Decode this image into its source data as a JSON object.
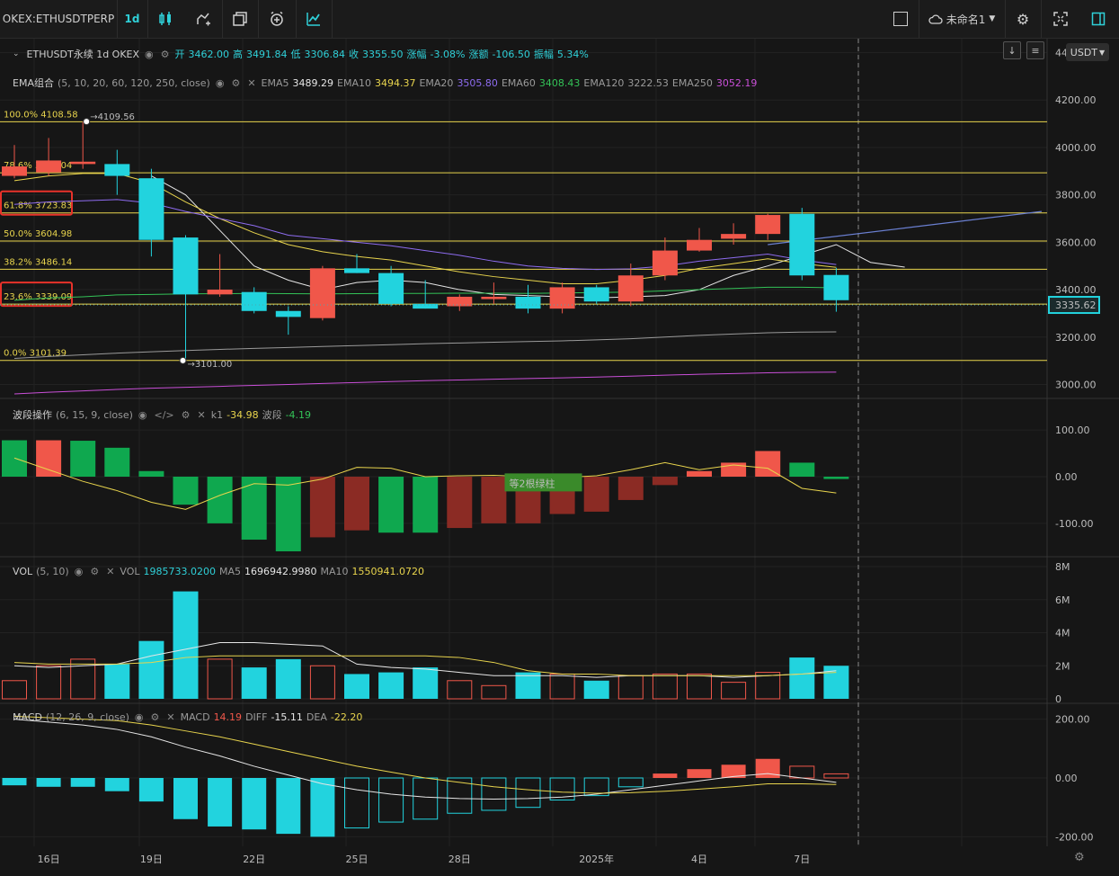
{
  "toolbar": {
    "symbol": "OKEX:ETHUSDTPERP",
    "interval": "1d",
    "layout_name": "未命名1",
    "currency": "USDT"
  },
  "header": {
    "title": "ETHUSDT永续 1d OKEX",
    "open_label": "开",
    "open": "3462.00",
    "high_label": "高",
    "high": "3491.84",
    "low_label": "低",
    "low": "3306.84",
    "close_label": "收",
    "close": "3355.50",
    "chg_pct_label": "涨幅",
    "chg_pct": "-3.08%",
    "chg_label": "涨额",
    "chg": "-106.50",
    "amp_label": "振幅",
    "amp": "5.34%"
  },
  "ema": {
    "name": "EMA组合",
    "params": "(5, 10, 20, 60, 120, 250, close)",
    "values": [
      {
        "label": "EMA5",
        "value": "3489.29",
        "color": "#e6e6e6"
      },
      {
        "label": "EMA10",
        "value": "3494.37",
        "color": "#e8d44d"
      },
      {
        "label": "EMA20",
        "value": "3505.80",
        "color": "#8e6cf0"
      },
      {
        "label": "EMA60",
        "value": "3408.43",
        "color": "#33c257"
      },
      {
        "label": "EMA120",
        "value": "3222.53",
        "color": "#9a9a9a"
      },
      {
        "label": "EMA250",
        "value": "3052.19",
        "color": "#c94fd8"
      }
    ]
  },
  "osc": {
    "name": "波段操作",
    "params": "(6, 15, 9, close)",
    "k1_label": "k1",
    "k1": "-34.98",
    "band_label": "波段",
    "band": "-4.19",
    "annotation": "等2根绿柱"
  },
  "vol": {
    "name": "VOL",
    "params": "(5, 10)",
    "vol_label": "VOL",
    "vol": "1985733.0200",
    "ma5_label": "MA5",
    "ma5": "1696942.9980",
    "ma10_label": "MA10",
    "ma10": "1550941.0720"
  },
  "macd": {
    "name": "MACD",
    "params": "(12, 26, 9, close)",
    "macd_label": "MACD",
    "macd": "14.19",
    "diff_label": "DIFF",
    "diff": "-15.11",
    "dea_label": "DEA",
    "dea": "-22.20"
  },
  "chart_data": {
    "type": "candlestick",
    "price_axis": {
      "ylim": [
        2960,
        4440
      ],
      "ticks": [
        "4400.00",
        "4200.00",
        "4000.00",
        "3800.00",
        "3600.00",
        "3400.00",
        "3200.00",
        "3000.00"
      ],
      "last_price": "3335.62"
    },
    "osc_axis": {
      "ylim": [
        -160,
        160
      ],
      "ticks": [
        "100.00",
        "0.00",
        "-100.00"
      ]
    },
    "vol_axis": {
      "ylim": [
        0,
        8
      ],
      "ticks": [
        "8M",
        "6M",
        "4M",
        "2M",
        "0"
      ]
    },
    "macd_axis": {
      "ylim": [
        -260,
        260
      ],
      "ticks": [
        "200.00",
        "0.00",
        "-200.00"
      ]
    },
    "x_labels": [
      {
        "i": 1,
        "label": "16日"
      },
      {
        "i": 4,
        "label": "19日"
      },
      {
        "i": 7,
        "label": "22日"
      },
      {
        "i": 10,
        "label": "25日"
      },
      {
        "i": 13,
        "label": "28日"
      },
      {
        "i": 17,
        "label": "2025年"
      },
      {
        "i": 20,
        "label": "4日"
      },
      {
        "i": 23,
        "label": "7日"
      }
    ],
    "fib_levels": [
      {
        "label": "100.0% 4108.58",
        "value": 4108.58,
        "color": "#e8d44d"
      },
      {
        "label": "78.6% 3893.04",
        "value": 3893.04,
        "color": "#e8d44d"
      },
      {
        "label": "61.8% 3723.83",
        "value": 3723.83,
        "color": "#e8d44d",
        "boxed": true
      },
      {
        "label": "50.0% 3604.98",
        "value": 3604.98,
        "color": "#e8d44d"
      },
      {
        "label": "38.2% 3486.14",
        "value": 3486.14,
        "color": "#e8d44d"
      },
      {
        "label": "23.6% 3339.09",
        "value": 3339.09,
        "color": "#e8d44d",
        "boxed": true
      },
      {
        "label": "0.0% 3101.39",
        "value": 3101.39,
        "color": "#e8d44d"
      }
    ],
    "high_marker": {
      "i": 2,
      "value": 4109.56,
      "label": "4109.56"
    },
    "low_marker": {
      "i": 5,
      "value": 3101.0,
      "label": "3101.00"
    },
    "candles": [
      {
        "o": 3880,
        "h": 4010,
        "l": 3870,
        "c": 3920
      },
      {
        "o": 3895,
        "h": 4040,
        "l": 3880,
        "c": 3945
      },
      {
        "o": 3930,
        "h": 4109.56,
        "l": 3910,
        "c": 3940
      },
      {
        "o": 3930,
        "h": 3990,
        "l": 3800,
        "c": 3880
      },
      {
        "o": 3870,
        "h": 3910,
        "l": 3540,
        "c": 3610
      },
      {
        "o": 3620,
        "h": 3630,
        "l": 3101,
        "c": 3380
      },
      {
        "o": 3380,
        "h": 3550,
        "l": 3370,
        "c": 3400
      },
      {
        "o": 3390,
        "h": 3410,
        "l": 3300,
        "c": 3310
      },
      {
        "o": 3310,
        "h": 3330,
        "l": 3210,
        "c": 3285
      },
      {
        "o": 3280,
        "h": 3500,
        "l": 3270,
        "c": 3490
      },
      {
        "o": 3490,
        "h": 3550,
        "l": 3470,
        "c": 3470
      },
      {
        "o": 3470,
        "h": 3500,
        "l": 3330,
        "c": 3340
      },
      {
        "o": 3340,
        "h": 3440,
        "l": 3320,
        "c": 3320
      },
      {
        "o": 3330,
        "h": 3380,
        "l": 3310,
        "c": 3370
      },
      {
        "o": 3360,
        "h": 3430,
        "l": 3340,
        "c": 3370
      },
      {
        "o": 3370,
        "h": 3420,
        "l": 3300,
        "c": 3320
      },
      {
        "o": 3320,
        "h": 3430,
        "l": 3300,
        "c": 3410
      },
      {
        "o": 3410,
        "h": 3420,
        "l": 3340,
        "c": 3350
      },
      {
        "o": 3350,
        "h": 3510,
        "l": 3330,
        "c": 3460
      },
      {
        "o": 3460,
        "h": 3620,
        "l": 3440,
        "c": 3565
      },
      {
        "o": 3565,
        "h": 3660,
        "l": 3560,
        "c": 3610
      },
      {
        "o": 3615,
        "h": 3680,
        "l": 3590,
        "c": 3635
      },
      {
        "o": 3635,
        "h": 3720,
        "l": 3610,
        "c": 3715
      },
      {
        "o": 3720,
        "h": 3745,
        "l": 3440,
        "c": 3460
      },
      {
        "o": 3462,
        "h": 3491.84,
        "l": 3306.84,
        "c": 3355.5
      }
    ],
    "ema_series": [
      {
        "name": "EMA5",
        "color": "#e6e6e6",
        "start": 4,
        "values": [
          3880,
          3800,
          3650,
          3500,
          3440,
          3400,
          3430,
          3440,
          3430,
          3400,
          3380,
          3375,
          3370,
          3365,
          3370,
          3375,
          3400,
          3460,
          3500,
          3545,
          3590,
          3515,
          3495
        ]
      },
      {
        "name": "EMA10",
        "color": "#e8d44d",
        "start": 0,
        "values": [
          3860,
          3880,
          3890,
          3890,
          3850,
          3770,
          3700,
          3640,
          3590,
          3560,
          3540,
          3525,
          3500,
          3475,
          3455,
          3440,
          3425,
          3425,
          3440,
          3460,
          3490,
          3510,
          3530,
          3510,
          3494
        ]
      },
      {
        "name": "EMA20",
        "color": "#8e6cf0",
        "start": 0,
        "values": [
          3760,
          3770,
          3775,
          3780,
          3765,
          3730,
          3700,
          3670,
          3630,
          3615,
          3600,
          3585,
          3565,
          3545,
          3520,
          3500,
          3490,
          3485,
          3488,
          3500,
          3520,
          3535,
          3550,
          3525,
          3506
        ]
      },
      {
        "name": "EMA60",
        "color": "#33c257",
        "start": 0,
        "values": [
          3355,
          3365,
          3370,
          3378,
          3380,
          3382,
          3383,
          3384,
          3383,
          3382,
          3383,
          3384,
          3384,
          3385,
          3385,
          3384,
          3386,
          3388,
          3390,
          3395,
          3400,
          3405,
          3410,
          3410,
          3408
        ]
      },
      {
        "name": "EMA120",
        "color": "#9a9a9a",
        "start": 0,
        "values": [
          3110,
          3118,
          3125,
          3132,
          3138,
          3143,
          3148,
          3152,
          3156,
          3160,
          3164,
          3168,
          3172,
          3175,
          3178,
          3181,
          3184,
          3188,
          3193,
          3200,
          3207,
          3213,
          3218,
          3221,
          3222
        ]
      },
      {
        "name": "EMA250",
        "color": "#c94fd8",
        "start": 0,
        "values": [
          2960,
          2967,
          2973,
          2979,
          2984,
          2988,
          2992,
          2996,
          3000,
          3004,
          3008,
          3012,
          3016,
          3019,
          3022,
          3025,
          3028,
          3031,
          3035,
          3039,
          3043,
          3046,
          3049,
          3051,
          3052
        ]
      }
    ],
    "trend_line": {
      "color": "#6a7fd1",
      "from": {
        "i": 22,
        "value": 3590
      },
      "to": {
        "i": 30,
        "value": 3730
      }
    },
    "osc_bars": [
      78,
      78,
      77,
      62,
      12,
      -60,
      -100,
      -135,
      -160,
      -130,
      -115,
      -120,
      -120,
      -110,
      -100,
      -100,
      -80,
      -75,
      -50,
      -18,
      12,
      30,
      55,
      30,
      -5
    ],
    "osc_bar_colors": [
      "#0fa84f",
      "#f0574a",
      "#0fa84f",
      "#0fa84f",
      "#0fa84f",
      "#0fa84f",
      "#0fa84f",
      "#0fa84f",
      "#0fa84f",
      "#8b2b24",
      "#8b2b24",
      "#0fa84f",
      "#0fa84f",
      "#8b2b24",
      "#8b2b24",
      "#8b2b24",
      "#8b2b24",
      "#8b2b24",
      "#8b2b24",
      "#8b2b24",
      "#f0574a",
      "#f0574a",
      "#f0574a",
      "#0fa84f",
      "#0fa84f"
    ],
    "osc_line": [
      40,
      15,
      -10,
      -30,
      -55,
      -70,
      -40,
      -15,
      -18,
      -5,
      20,
      18,
      0,
      2,
      3,
      0,
      -2,
      2,
      15,
      30,
      15,
      25,
      18,
      -25,
      -35
    ],
    "vol_bars": [
      1.1,
      2.0,
      2.4,
      2.1,
      3.5,
      6.5,
      2.4,
      1.9,
      2.4,
      2.0,
      1.5,
      1.6,
      1.9,
      1.1,
      0.8,
      1.6,
      1.5,
      1.1,
      1.4,
      1.5,
      1.5,
      1.0,
      1.6,
      2.5,
      2.0
    ],
    "vol_ma5": [
      2.0,
      1.9,
      2.0,
      2.1,
      2.6,
      3.0,
      3.4,
      3.4,
      3.3,
      3.2,
      2.1,
      1.9,
      1.8,
      1.6,
      1.4,
      1.4,
      1.4,
      1.3,
      1.4,
      1.4,
      1.4,
      1.3,
      1.4,
      1.5,
      1.7
    ],
    "vol_ma10": [
      2.2,
      2.1,
      2.1,
      2.1,
      2.2,
      2.5,
      2.6,
      2.6,
      2.6,
      2.6,
      2.6,
      2.6,
      2.6,
      2.5,
      2.2,
      1.7,
      1.5,
      1.5,
      1.4,
      1.4,
      1.4,
      1.4,
      1.4,
      1.5,
      1.6
    ],
    "macd_bars": [
      -25,
      -30,
      -30,
      -45,
      -80,
      -140,
      -165,
      -175,
      -190,
      -200,
      -170,
      -150,
      -140,
      -120,
      -110,
      -100,
      -75,
      -60,
      -30,
      15,
      30,
      45,
      65,
      40,
      14
    ],
    "macd_diff": [
      200,
      190,
      180,
      165,
      140,
      105,
      75,
      40,
      10,
      -20,
      -40,
      -55,
      -65,
      -70,
      -72,
      -70,
      -65,
      -55,
      -40,
      -25,
      -10,
      5,
      15,
      0,
      -15
    ],
    "macd_dea": [
      210,
      205,
      200,
      195,
      180,
      160,
      140,
      115,
      90,
      65,
      40,
      20,
      0,
      -15,
      -30,
      -40,
      -48,
      -52,
      -50,
      -45,
      -38,
      -30,
      -20,
      -20,
      -22
    ]
  }
}
